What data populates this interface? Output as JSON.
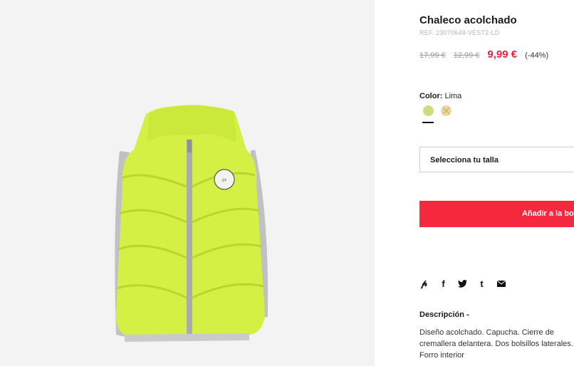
{
  "product": {
    "title": "Chaleco acolchado",
    "reference": "REF. 23070648-VEST2-LD",
    "image_alt": "Chaleco acolchado verde lima"
  },
  "prices": {
    "original_1": "17,99 €",
    "original_2": "12,99 €",
    "current": "9,99 €",
    "discount": "(-44%)"
  },
  "color": {
    "label": "Color:",
    "selected": "Lima",
    "swatches": [
      {
        "name": "lima",
        "hex": "#c8e07a"
      },
      {
        "name": "beige",
        "hex": "#ecd7a0"
      }
    ]
  },
  "size_select": {
    "label": "Selecciona tu talla"
  },
  "add_to_bag": {
    "label": "Añadir a la bolsa"
  },
  "share_icons": [
    "pinterest-icon",
    "facebook-icon",
    "twitter-icon",
    "tumblr-icon",
    "email-icon"
  ],
  "description": {
    "title": "Descripción -",
    "text": "Diseño acolchado. Capucha. Cierre de cremallera delantera. Dos bolsillos laterales. Forro interior"
  },
  "colors": {
    "accent": "#f5283d",
    "price": "#e8223d",
    "vest": "#d4f045",
    "trim": "#b9bcbd"
  }
}
